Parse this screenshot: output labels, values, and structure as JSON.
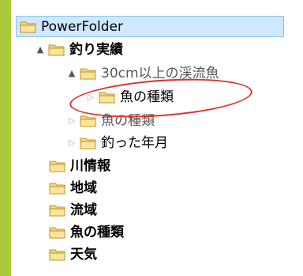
{
  "tree": {
    "root": {
      "label": "PowerFolder"
    },
    "nodes": [
      {
        "id": "tsuri-jisseki",
        "label": "釣り実績",
        "expander": "▲"
      },
      {
        "id": "30cm-keiryuugyo",
        "label": "30cm以上の渓流魚",
        "expander": "▲"
      },
      {
        "id": "sakana-no-shurui-child",
        "label": "魚の種類",
        "expander": "▷"
      },
      {
        "id": "sakana-no-shurui-2",
        "label": "魚の種類",
        "expander": "▷"
      },
      {
        "id": "tsutta-nengetsu",
        "label": "釣った年月",
        "expander": "▷"
      },
      {
        "id": "kawa-jouhou",
        "label": "川情報"
      },
      {
        "id": "chiiki",
        "label": "地域"
      },
      {
        "id": "ryuuiki",
        "label": "流域"
      },
      {
        "id": "sakana-no-shurui-3",
        "label": "魚の種類"
      },
      {
        "id": "tenki",
        "label": "天気"
      }
    ]
  },
  "colors": {
    "root_highlight": "#cde8ff",
    "folder_yellow": "#f7d774",
    "annotation_red": "#e0302b",
    "side_bar_green": "#a9c93a"
  }
}
